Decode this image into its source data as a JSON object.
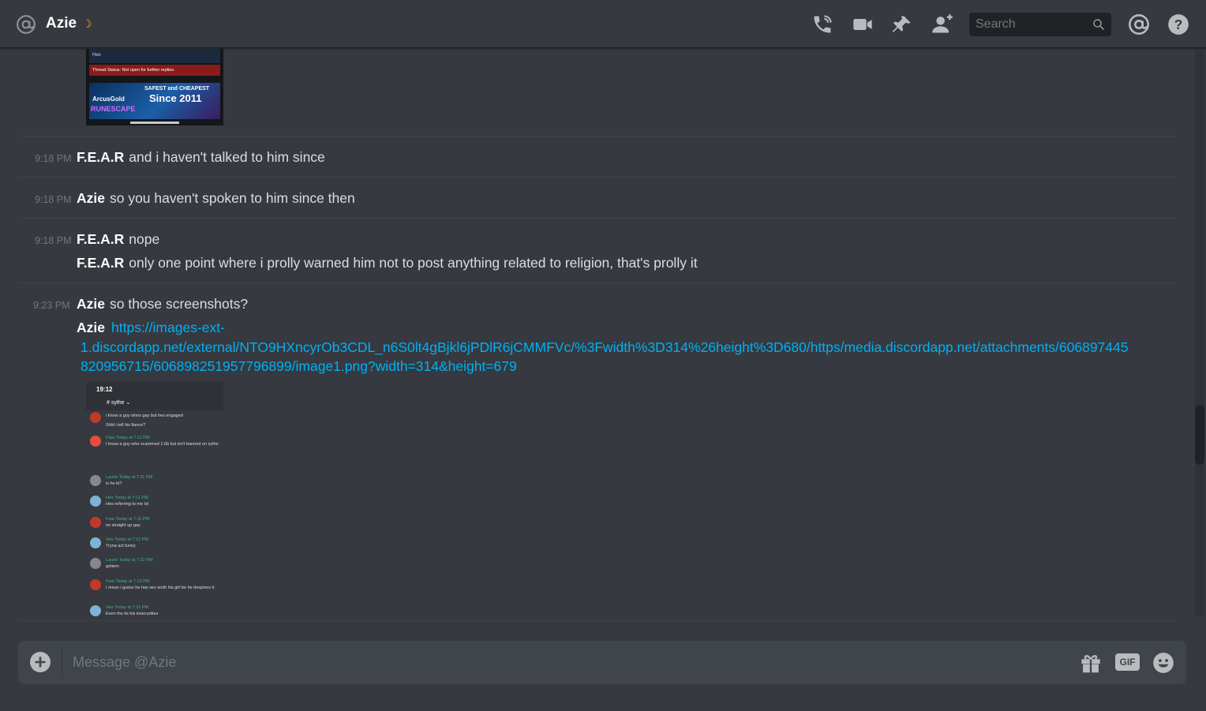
{
  "header": {
    "channel_name": "Azie",
    "status_glyph": "☽",
    "search_placeholder": "Search",
    "icons": [
      "at-icon",
      "phone-call-icon",
      "video-call-icon",
      "pin-icon",
      "add-friend-icon",
      "search-icon",
      "mentions-icon",
      "help-icon"
    ]
  },
  "attachment_preview_1": {
    "user_label": "Hex",
    "thread_status": "Thread Status: Not open for further replies.",
    "banner_line1": "SAFEST and CHEAPEST",
    "banner_line2": "Since 2011",
    "brand": "ArcusGold",
    "brand2": "RUNESCAPE"
  },
  "messages": [
    {
      "timestamp": "9:18 PM",
      "author": "F.E.A.R",
      "text": "and i haven't talked to him since"
    },
    {
      "timestamp": "9:18 PM",
      "author": "Azie",
      "text": "so you haven't spoken to him since then"
    },
    {
      "timestamp": "9:18 PM",
      "author": "F.E.A.R",
      "text": "nope",
      "followup": {
        "author": "F.E.A.R",
        "text": "only one point where i prolly warned him not to post anything related to religion, that's prolly it"
      }
    },
    {
      "timestamp": "9:23 PM",
      "author": "Azie",
      "text": "so those screenshots?",
      "followup": {
        "author": "Azie",
        "link_line1": "https://images-ext-",
        "link_line2": "1.discordapp.net/external/NTO9HXncyrOb3CDL_n6S0lt4gBjkl6jPDlR6jCMMFVc/%3Fwidth%3D314%26height%3D680/https/media.discordapp.net/attachments/606897445",
        "link_line3": "820956715/606898251957796899/image1.png?width=314&height=679"
      }
    }
  ],
  "attachment_preview_2": {
    "time": "19:12",
    "channel": "# sythe ⌄",
    "rows": [
      {
        "name": "",
        "text": "i know a guy whos gay but hes engaged",
        "color": "#c0392b"
      },
      {
        "name": "",
        "text": "Shld i tell his fiance?",
        "color": "#c0392b"
      },
      {
        "name": "Flipz Today at 7:11 PM",
        "text": "I know a guy who scammed 1.6b but isn't banned on sythe",
        "color": "#e74c3c"
      },
      {
        "name": "Laurie Today at 7:11 PM",
        "text": "is he bi?",
        "color": "#888888"
      },
      {
        "name": "Hex Today at 7:11 PM",
        "text": "Hes referring to me lol",
        "color": "#7fb3d5"
      },
      {
        "name": "Fear Today at 7:11 PM",
        "text": "no straight up gay",
        "color": "#c0392b"
      },
      {
        "name": "Hex Today at 7:12 PM",
        "text": "Tryna act funny",
        "color": "#7fb3d5"
      },
      {
        "name": "Laurie Today at 7:12 PM",
        "text": "gottem",
        "color": "#888888"
      },
      {
        "name": "Fear Today at 7:12 PM",
        "text": "I mean i guess he has sex woth his girl be he despises it",
        "color": "#c0392b"
      },
      {
        "name": "Hex Today at 7:12 PM",
        "text": "Even tho its his insecurities",
        "color": "#7fb3d5"
      }
    ]
  },
  "composer": {
    "placeholder": "Message @Azie",
    "gif_label": "GIF"
  },
  "colors": {
    "background": "#36393f",
    "header_text": "#ffffff",
    "link": "#00b0f4",
    "timestamp": "#72767d",
    "composer_bg": "#40444b"
  }
}
